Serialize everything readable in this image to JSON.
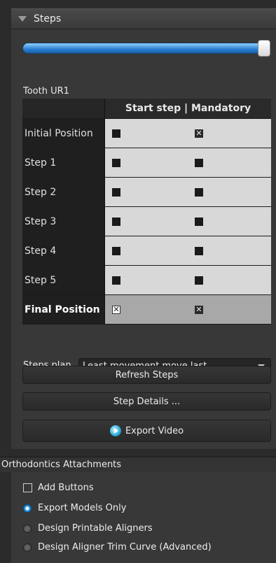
{
  "steps_panel": {
    "title": "Steps",
    "tooth_label": "Tooth UR1",
    "slider_value": 1.0,
    "columns_header": "Start step | Mandatory",
    "rows": [
      {
        "label": "Initial Position",
        "start": "checked",
        "mandatory": "crossed"
      },
      {
        "label": "Step 1",
        "start": "checked",
        "mandatory": "checked"
      },
      {
        "label": "Step 2",
        "start": "checked",
        "mandatory": "checked"
      },
      {
        "label": "Step 3",
        "start": "checked",
        "mandatory": "checked"
      },
      {
        "label": "Step 4",
        "start": "checked",
        "mandatory": "checked"
      },
      {
        "label": "Step 5",
        "start": "checked",
        "mandatory": "checked"
      },
      {
        "label": "Final Position",
        "start": "crossed-outline",
        "mandatory": "crossed"
      }
    ],
    "plan_label": "Steps plan",
    "plan_value": "Least movement move last",
    "refresh_label": "Refresh Steps",
    "details_label": "Step Details ...",
    "export_label": "Export Video"
  },
  "attachments": {
    "title": "Orthodontics Attachments",
    "add_buttons": "Add Buttons",
    "options": [
      "Export Models Only",
      "Design Printable Aligners",
      "Design Aligner Trim Curve (Advanced)"
    ],
    "selected": "Export Models Only"
  },
  "colors": {
    "accent": "#2a7fd1",
    "panel": "#383838",
    "background": "#2b2b2b"
  }
}
